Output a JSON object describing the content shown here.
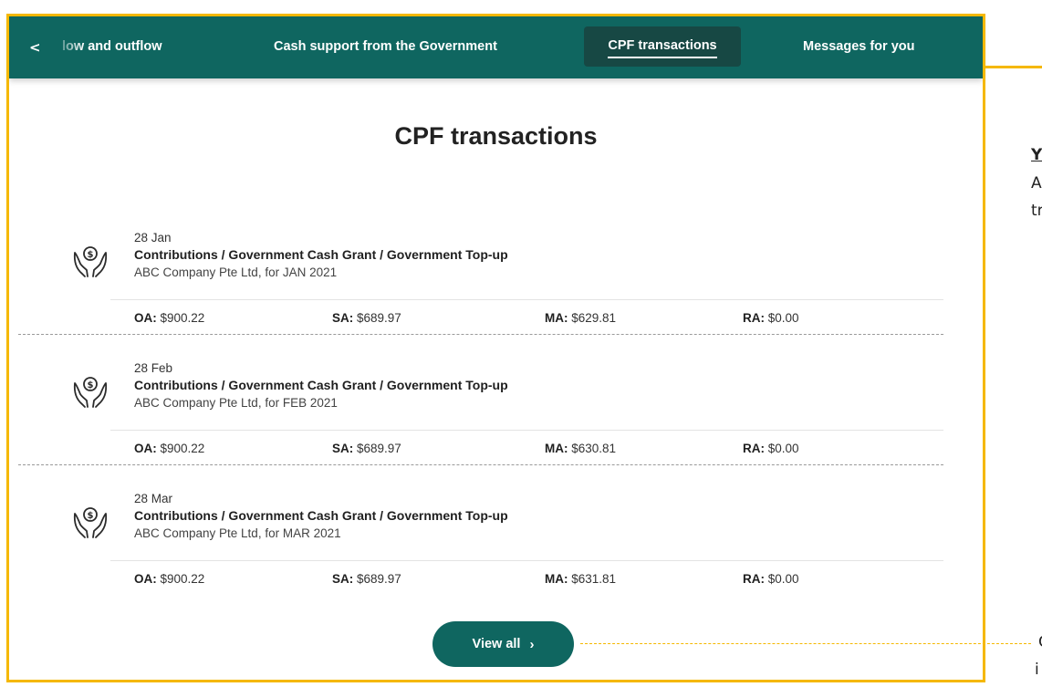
{
  "navbar": {
    "back_glyph": "<",
    "tabs": [
      {
        "label": "low and outflow",
        "active": false
      },
      {
        "label": "Cash support from the Government",
        "active": false
      },
      {
        "label": "CPF transactions",
        "active": true
      },
      {
        "label": "Messages for you",
        "active": false
      }
    ]
  },
  "page_title": "CPF transactions",
  "icons": {
    "transaction": "money-hands-icon",
    "back": "chevron-left-icon",
    "view_all": "chevron-right-icon"
  },
  "transactions": [
    {
      "date": "28 Jan",
      "type": "Contributions / Government Cash Grant / Government Top-up",
      "employer": "ABC Company Pte Ltd, for JAN 2021",
      "oa_label": "OA:",
      "oa": "$900.22",
      "sa_label": "SA:",
      "sa": "$689.97",
      "ma_label": "MA:",
      "ma": "$629.81",
      "ra_label": "RA:",
      "ra": "$0.00"
    },
    {
      "date": "28 Feb",
      "type": "Contributions / Government Cash Grant / Government Top-up",
      "employer": "ABC Company Pte Ltd, for FEB 2021",
      "oa_label": "OA:",
      "oa": "$900.22",
      "sa_label": "SA:",
      "sa": "$689.97",
      "ma_label": "MA:",
      "ma": "$630.81",
      "ra_label": "RA:",
      "ra": "$0.00"
    },
    {
      "date": "28 Mar",
      "type": "Contributions / Government Cash Grant / Government Top-up",
      "employer": "ABC Company Pte Ltd, for MAR 2021",
      "oa_label": "OA:",
      "oa": "$900.22",
      "sa_label": "SA:",
      "sa": "$689.97",
      "ma_label": "MA:",
      "ma": "$631.81",
      "ra_label": "RA:",
      "ra": "$0.00"
    }
  ],
  "view_all": {
    "label": "View all",
    "chevron": "›"
  },
  "side_text": {
    "line1": "Y",
    "line2": "A",
    "line3": "tr",
    "line4": "C",
    "line5": "i"
  },
  "colors": {
    "brand": "#0f6660",
    "active_tab": "#174844",
    "highlight": "#f5b800"
  }
}
